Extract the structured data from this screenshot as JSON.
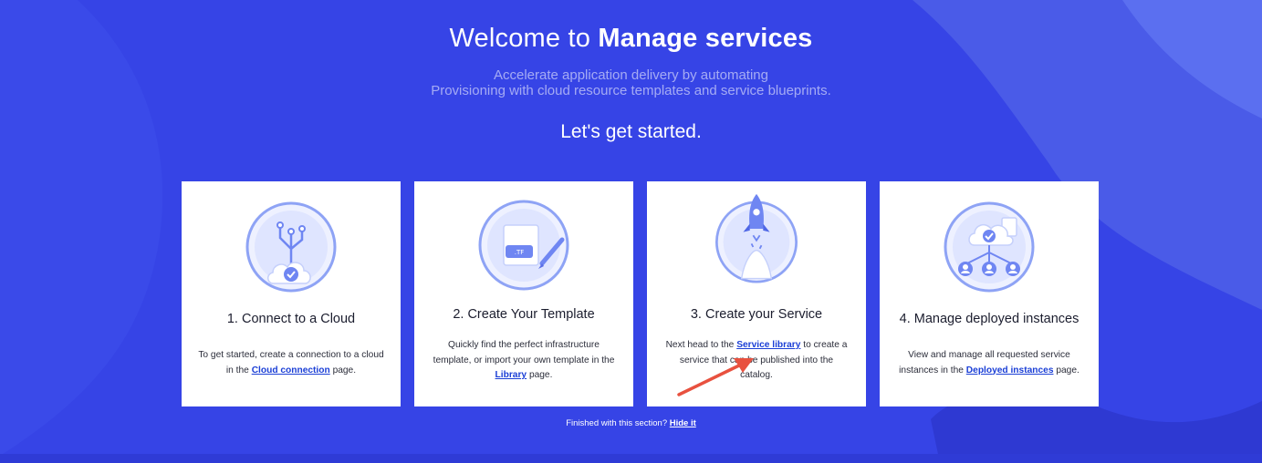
{
  "header": {
    "title_prefix": "Welcome to",
    "title_bold": "Manage services",
    "subtitle_line1": "Accelerate application delivery by automating",
    "subtitle_line2": "Provisioning with cloud resource templates and service blueprints.",
    "started": "Let's get started."
  },
  "cards": [
    {
      "title": "1. Connect to a Cloud",
      "text_before": "To get started, create a connection to a cloud in the",
      "link": "Cloud connection",
      "text_after": "page.",
      "icon": "cloud-branch-icon"
    },
    {
      "title": "2. Create Your Template",
      "text_before": "Quickly find the perfect infrastructure template, or import your own template in the",
      "link": "Library",
      "text_after": "page.",
      "icon": "template-pencil-icon",
      "file_label": ".TF"
    },
    {
      "title": "3. Create your Service",
      "text_before": "Next head to the",
      "link": "Service library",
      "text_after": "to create a service that can be published into the catalog.",
      "icon": "rocket-icon"
    },
    {
      "title": "4. Manage deployed instances",
      "text_before": "View and manage all requested service instances in the",
      "link": "Deployed instances",
      "text_after": "page.",
      "icon": "cloud-users-icon"
    }
  ],
  "footer": {
    "text": "Finished with this section?",
    "link": "Hide it"
  },
  "colors": {
    "background": "#3644e6",
    "link": "#1b3fd6",
    "arrow": "#e8513f"
  }
}
